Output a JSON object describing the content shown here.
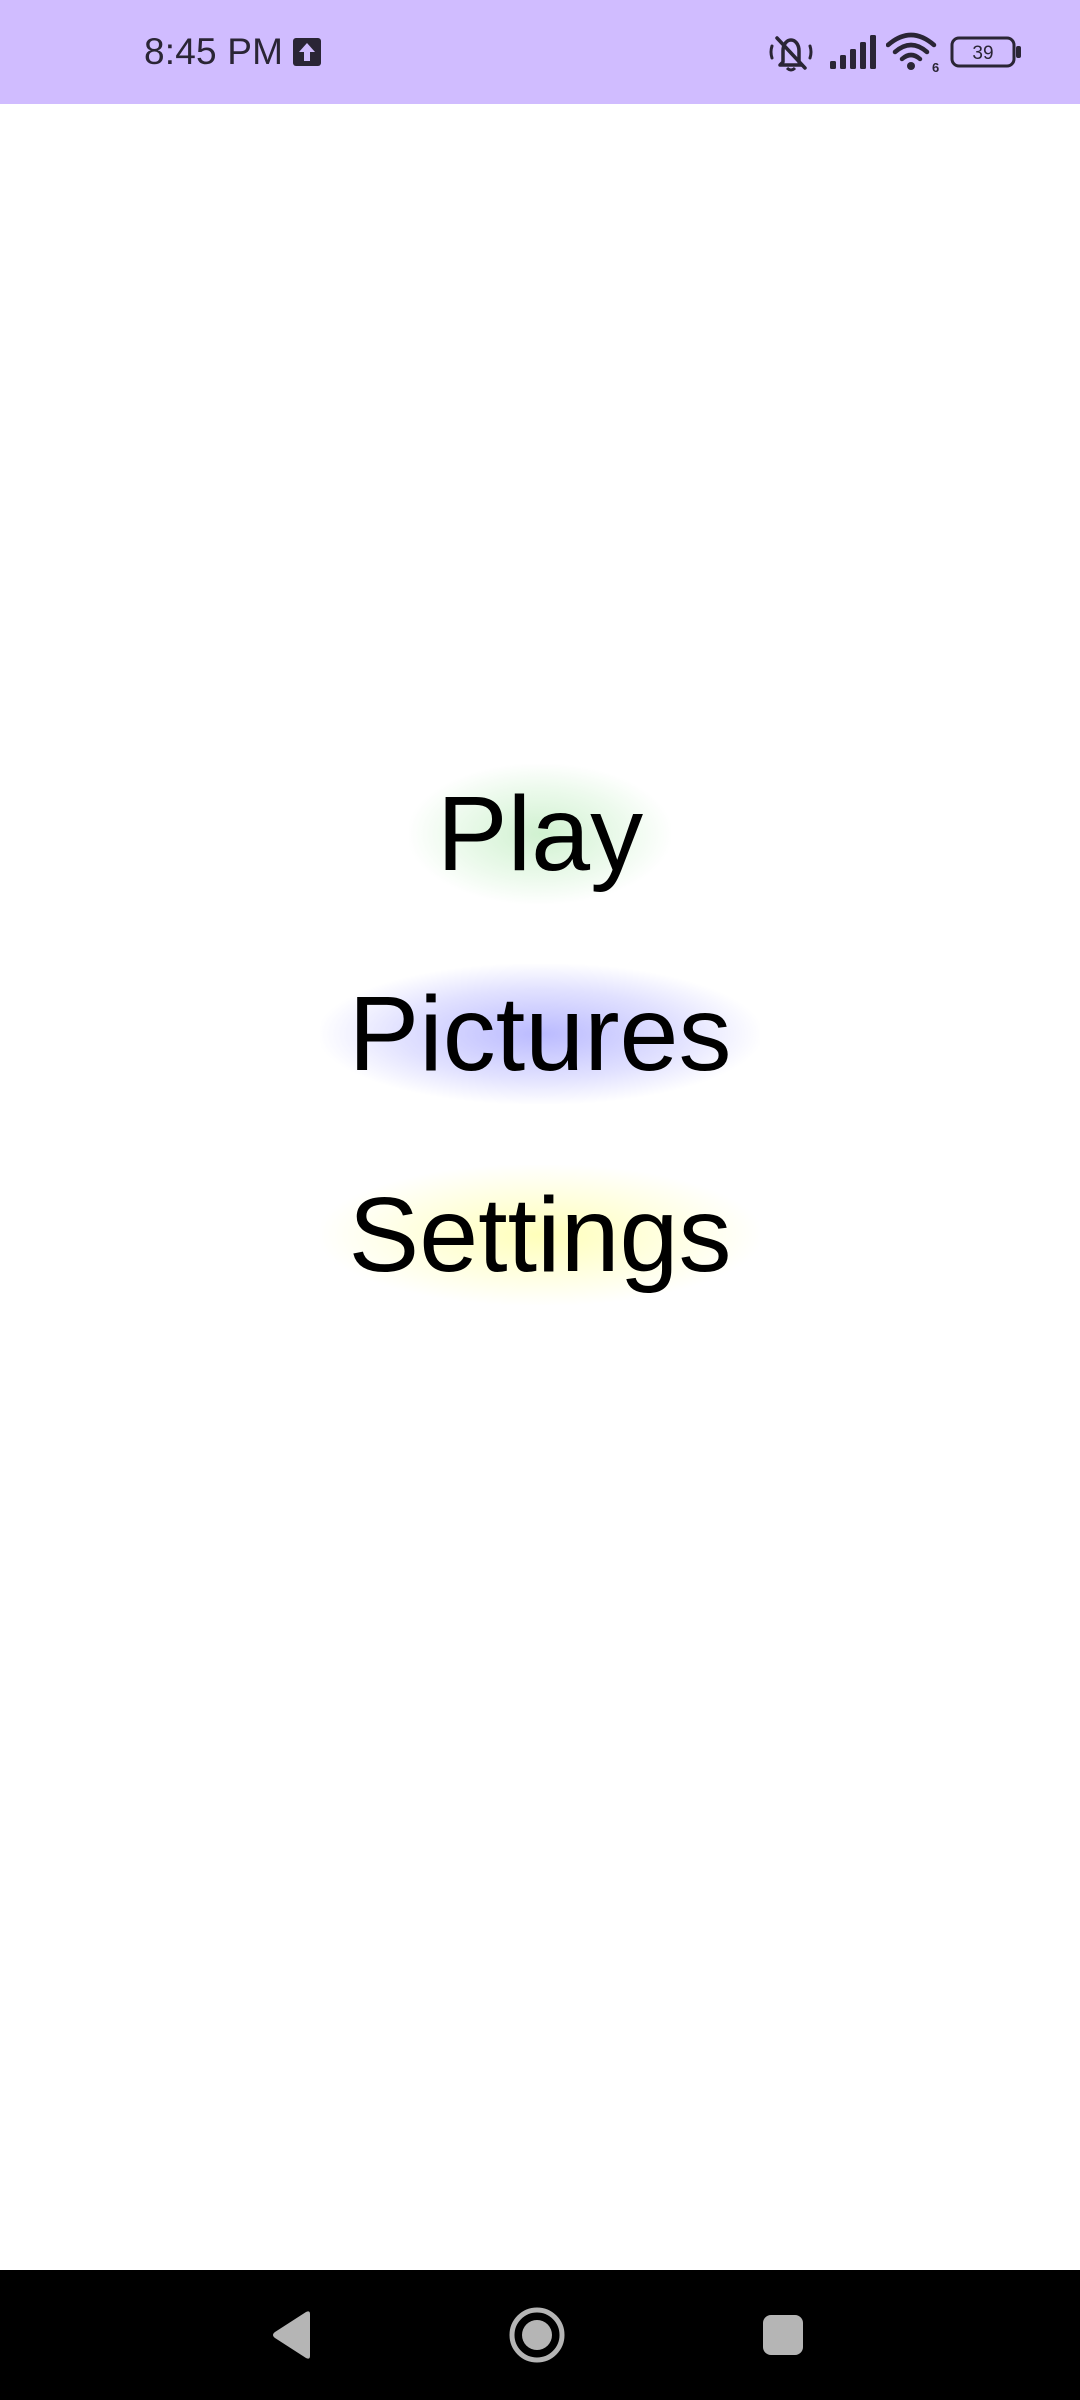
{
  "status_bar": {
    "time": "8:45 PM",
    "battery_level": "39",
    "background_color": "#d0bcff",
    "icons": [
      "upload-icon",
      "mute-icon",
      "signal-icon",
      "wifi-icon",
      "battery-icon"
    ],
    "wifi_badge": "6"
  },
  "menu": {
    "items": [
      {
        "label": "Play",
        "glow_color": "#aae6aa"
      },
      {
        "label": "Pictures",
        "glow_color": "#8282ff"
      },
      {
        "label": "Settings",
        "glow_color": "#ffff8c"
      }
    ]
  },
  "nav_bar": {
    "buttons": [
      "back-icon",
      "home-icon",
      "recents-icon"
    ]
  }
}
